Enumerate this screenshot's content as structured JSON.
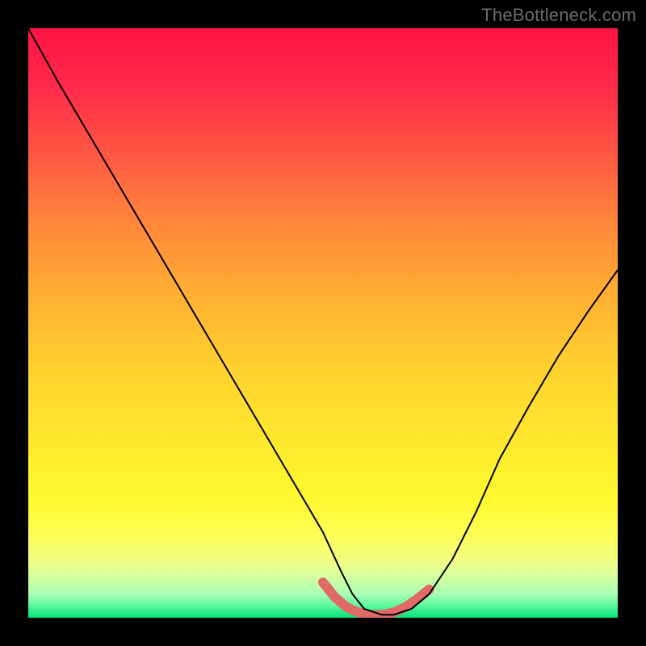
{
  "watermark": "TheBottleneck.com",
  "chart_data": {
    "type": "line",
    "title": "",
    "xlabel": "",
    "ylabel": "",
    "xlim": [
      0,
      100
    ],
    "ylim": [
      0,
      100
    ],
    "grid": false,
    "legend": false,
    "series": [
      {
        "name": "bottleneck-curve",
        "x": [
          0,
          5,
          10,
          15,
          20,
          25,
          30,
          35,
          40,
          45,
          50,
          53,
          55,
          57,
          60,
          62,
          65,
          68,
          72,
          76,
          80,
          85,
          90,
          95,
          100
        ],
        "values": [
          100,
          91,
          82.5,
          74,
          65.5,
          57,
          48.5,
          40,
          31.5,
          23,
          14.5,
          8,
          4,
          1.5,
          0.5,
          0.5,
          1.5,
          4,
          10,
          18,
          27,
          36,
          44.5,
          52,
          59
        ]
      },
      {
        "name": "highlight-segment",
        "x": [
          50,
          52,
          54,
          56,
          58,
          60,
          62,
          64,
          66,
          68
        ],
        "values": [
          6,
          3.5,
          1.8,
          0.9,
          0.5,
          0.5,
          0.9,
          1.8,
          3.2,
          4.8
        ]
      }
    ],
    "colors": {
      "curve": "#000000",
      "highlight": "#e06a66",
      "background_top": "#ff1445",
      "background_bottom": "#00e27a"
    }
  }
}
